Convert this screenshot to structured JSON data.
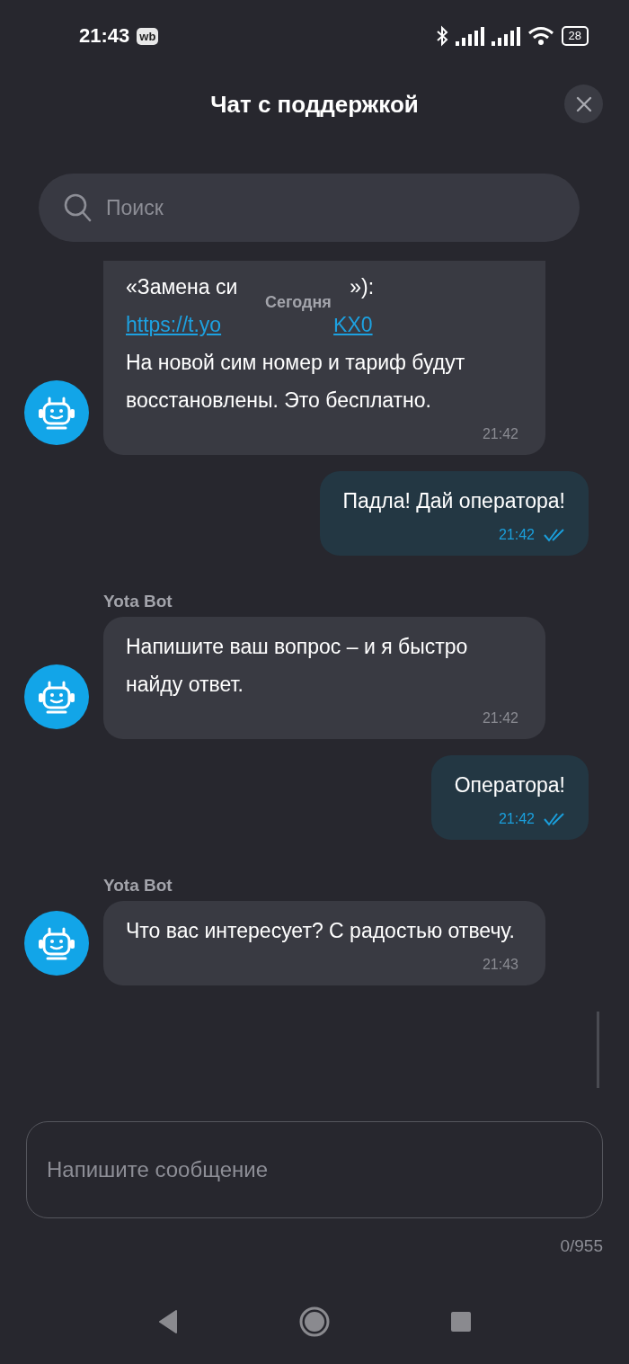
{
  "status_bar": {
    "time": "21:43",
    "app_badge": "wb",
    "battery": "28"
  },
  "header": {
    "title": "Чат с поддержкой"
  },
  "search": {
    "placeholder": "Поиск"
  },
  "date_chip": "Сегодня",
  "messages": [
    {
      "kind": "bot",
      "lines": [
        [
          {
            "text": "«Замена си",
            "link": false
          },
          {
            "text": "»):",
            "link": false
          }
        ],
        [
          {
            "text": "https://t.yo",
            "link": true
          },
          {
            "text": "KX0",
            "link": true
          }
        ],
        [
          {
            "text": "На новой сим номер и тариф будут восстановлены. Это бесплатно.",
            "link": false
          }
        ]
      ],
      "time": "21:42"
    },
    {
      "kind": "user",
      "text": "Падла! Дай оператора!",
      "time": "21:42",
      "read": true
    },
    {
      "kind": "bot",
      "sender": "Yota Bot",
      "text": "Напишите ваш вопрос – и я быстро найду ответ.",
      "time": "21:42"
    },
    {
      "kind": "user",
      "text": "Оператора!",
      "time": "21:42",
      "read": true
    },
    {
      "kind": "bot",
      "sender": "Yota Bot",
      "text": "Что вас интересует? С радостью отвечу.",
      "time": "21:43"
    }
  ],
  "composer": {
    "placeholder": "Напишите сообщение",
    "counter": "0/955"
  }
}
